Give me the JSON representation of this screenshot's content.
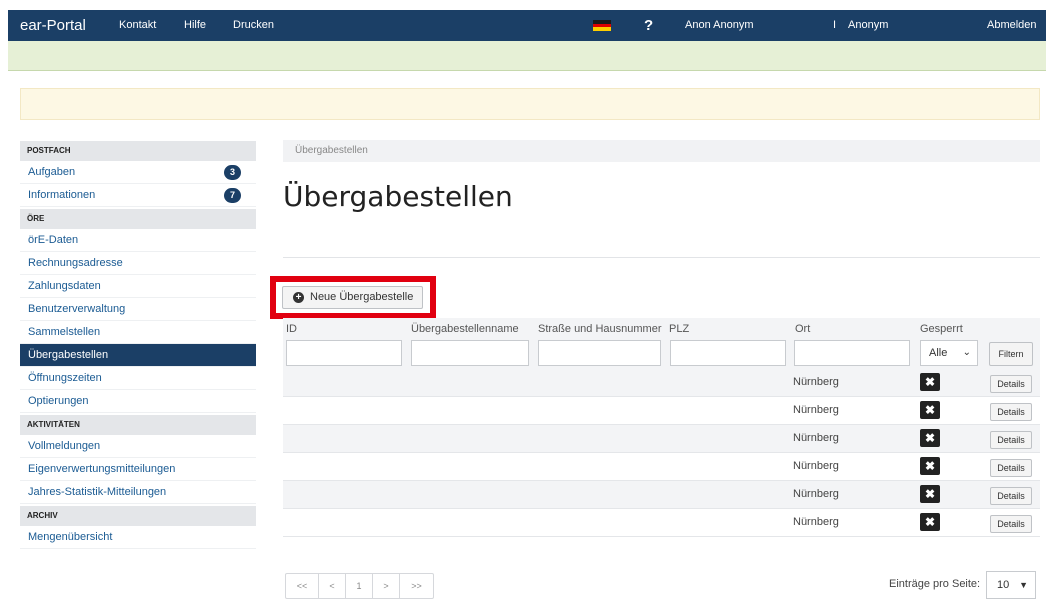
{
  "topbar": {
    "brand": "ear-Portal",
    "nav": [
      "Kontakt",
      "Hilfe",
      "Drucken"
    ],
    "help_symbol": "?",
    "user_name": "Anon Anonym",
    "org_separator": "I",
    "org_name": "Anonym",
    "logout": "Abmelden",
    "flag_colors": [
      "#1a1a1a",
      "#dd0000",
      "#ffce00"
    ]
  },
  "sidebar": {
    "sections": [
      {
        "title": "POSTFACH",
        "items": [
          {
            "label": "Aufgaben",
            "badge": "3"
          },
          {
            "label": "Informationen",
            "badge": "7"
          }
        ]
      },
      {
        "title": "ÖRE",
        "items": [
          {
            "label": "örE-Daten"
          },
          {
            "label": "Rechnungsadresse"
          },
          {
            "label": "Zahlungsdaten"
          },
          {
            "label": "Benutzerverwaltung"
          },
          {
            "label": "Sammelstellen"
          },
          {
            "label": "Übergabestellen",
            "active": true
          },
          {
            "label": "Öffnungszeiten"
          },
          {
            "label": "Optierungen"
          }
        ]
      },
      {
        "title": "AKTIVITÄTEN",
        "items": [
          {
            "label": "Vollmeldungen"
          },
          {
            "label": "Eigenverwertungsmitteilungen"
          },
          {
            "label": "Jahres-Statistik-Mitteilungen"
          }
        ]
      },
      {
        "title": "ARCHIV",
        "items": [
          {
            "label": "Mengenübersicht"
          }
        ]
      }
    ]
  },
  "main": {
    "breadcrumb": "Übergabestellen",
    "title": "Übergabestellen",
    "new_button": "Neue Übergabestelle",
    "columns": [
      "ID",
      "Übergabestellenname",
      "Straße und Hausnummer",
      "PLZ",
      "Ort",
      "Gesperrt"
    ],
    "gesperrt_filter": "Alle",
    "filter_button": "Filtern",
    "rows": [
      {
        "ort": "Nürnberg",
        "locked": "✖",
        "action": "Details"
      },
      {
        "ort": "Nürnberg",
        "locked": "✖",
        "action": "Details"
      },
      {
        "ort": "Nürnberg",
        "locked": "✖",
        "action": "Details"
      },
      {
        "ort": "Nürnberg",
        "locked": "✖",
        "action": "Details"
      },
      {
        "ort": "Nürnberg",
        "locked": "✖",
        "action": "Details"
      },
      {
        "ort": "Nürnberg",
        "locked": "✖",
        "action": "Details"
      }
    ],
    "pagination": [
      "<<",
      "<",
      "1",
      ">",
      ">>"
    ],
    "per_page_label": "Einträge pro Seite:",
    "per_page_value": "10"
  },
  "colors": {
    "navbar": "#1b3f66",
    "highlight_frame": "#e10010",
    "link": "#1b5b93"
  }
}
